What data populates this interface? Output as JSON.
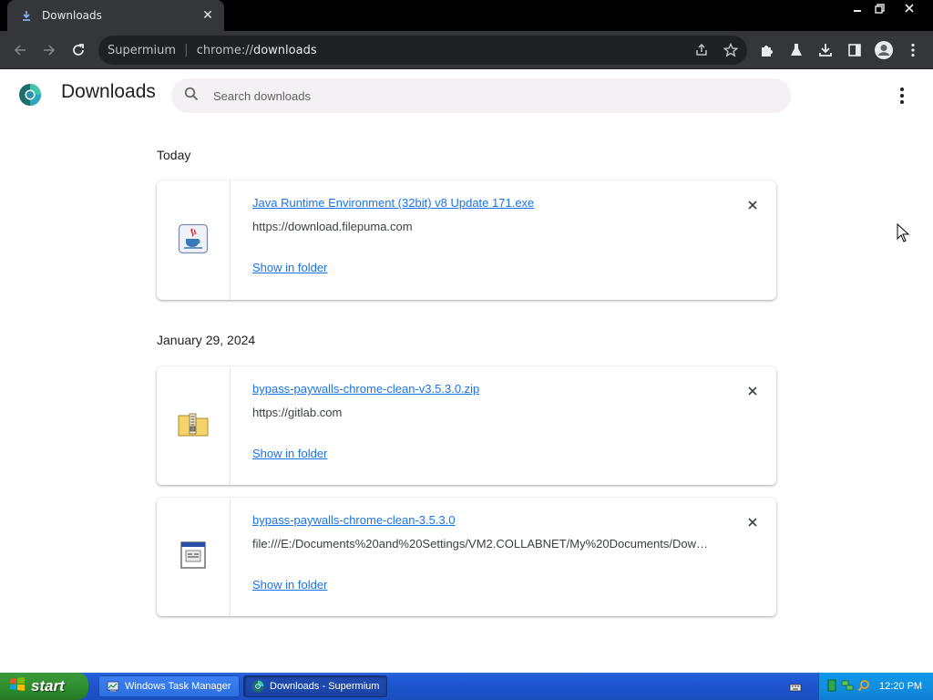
{
  "window": {
    "tab_title": "Downloads",
    "colors": {
      "titlebar": "#000000",
      "toolbar": "#35363a",
      "omnibox": "#202124",
      "link": "#1a73e8"
    }
  },
  "toolbar": {
    "omnibox_brand": "Supermium",
    "omnibox_scheme": "chrome://",
    "omnibox_path": "downloads"
  },
  "downloads_page": {
    "title": "Downloads",
    "search_placeholder": "Search downloads"
  },
  "sections": [
    {
      "date": "Today",
      "items": [
        {
          "filename": "Java Runtime Environment (32bit) v8 Update 171.exe",
          "url": "https://download.filepuma.com",
          "action": "Show in folder",
          "icon": "java-icon"
        }
      ]
    },
    {
      "date": "January 29, 2024",
      "items": [
        {
          "filename": "bypass-paywalls-chrome-clean-v3.5.3.0.zip",
          "url": "https://gitlab.com",
          "action": "Show in folder",
          "icon": "zip-folder-icon"
        },
        {
          "filename": "bypass-paywalls-chrome-clean-3.5.3.0",
          "url": "file:///E:/Documents%20and%20Settings/VM2.COLLABNET/My%20Documents/Down...",
          "action": "Show in folder",
          "icon": "generic-file-icon"
        }
      ]
    }
  ],
  "taskbar": {
    "start_label": "start",
    "tasks": [
      {
        "label": "Windows Task Manager",
        "active": false
      },
      {
        "label": "Downloads - Supermium",
        "active": true
      }
    ],
    "clock": "12:20 PM"
  }
}
